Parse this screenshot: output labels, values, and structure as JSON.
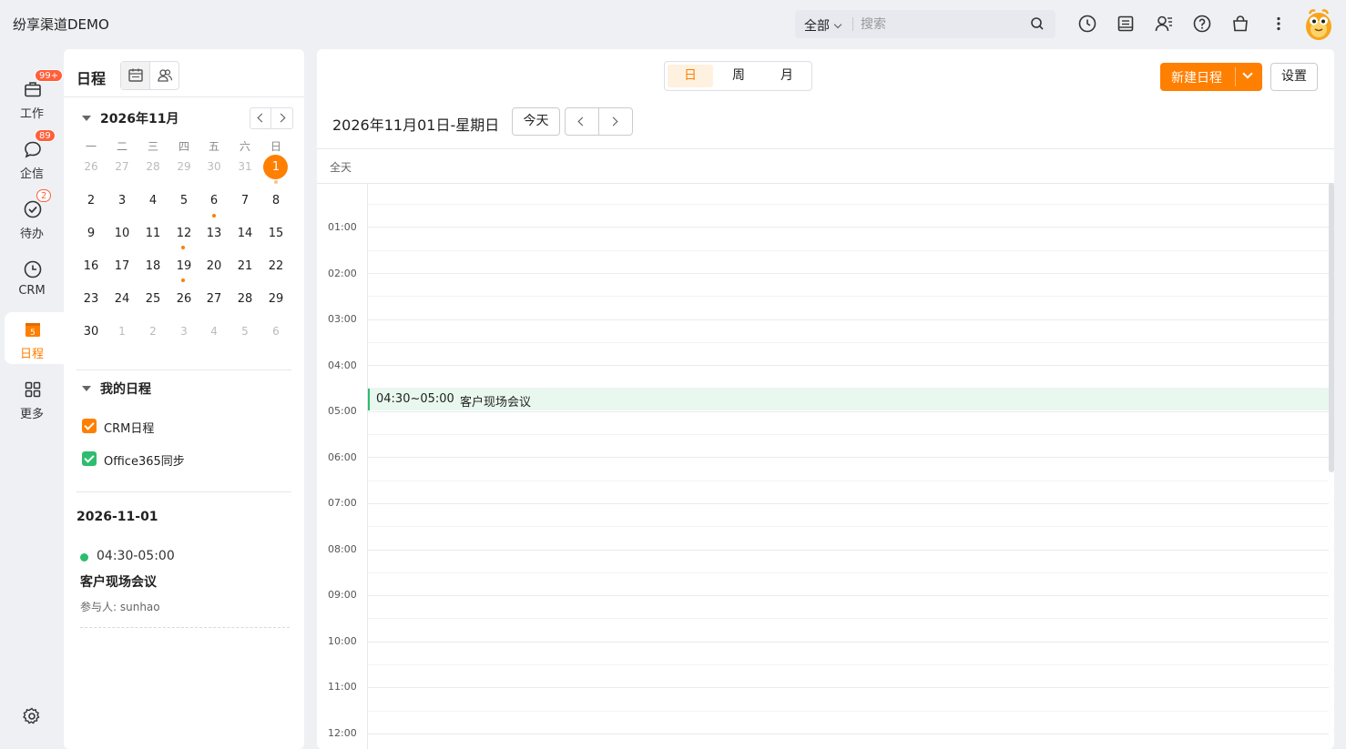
{
  "app": {
    "title": "纷享渠道DEMO"
  },
  "search": {
    "scope": "全部",
    "placeholder": "搜索"
  },
  "topbar_icons": [
    "clock-icon",
    "notes-icon",
    "contacts-icon",
    "help-icon",
    "bag-icon",
    "more-vertical-icon"
  ],
  "nav": {
    "items": [
      {
        "label": "工作",
        "icon": "briefcase-icon",
        "badge": "99+"
      },
      {
        "label": "企信",
        "icon": "chat-icon",
        "badge": "89"
      },
      {
        "label": "待办",
        "icon": "todo-check-icon",
        "badge": "2"
      },
      {
        "label": "CRM",
        "icon": "crm-clock-icon",
        "badge": ""
      },
      {
        "label": "日程",
        "icon": "calendar-icon",
        "badge": "",
        "icon_text": "5"
      },
      {
        "label": "更多",
        "icon": "grid-icon",
        "badge": ""
      }
    ],
    "active": "日程"
  },
  "sidebar": {
    "title": "日程",
    "month_label": "2026年11月",
    "weekdays": [
      "一",
      "二",
      "三",
      "四",
      "五",
      "六",
      "日"
    ],
    "weeks": [
      [
        "26",
        "27",
        "28",
        "29",
        "30",
        "31",
        "1"
      ],
      [
        "2",
        "3",
        "4",
        "5",
        "6",
        "7",
        "8"
      ],
      [
        "9",
        "10",
        "11",
        "12",
        "13",
        "14",
        "15"
      ],
      [
        "16",
        "17",
        "18",
        "19",
        "20",
        "21",
        "22"
      ],
      [
        "23",
        "24",
        "25",
        "26",
        "27",
        "28",
        "29"
      ],
      [
        "30",
        "1",
        "2",
        "3",
        "4",
        "5",
        "6"
      ]
    ],
    "selected_day": "1",
    "my_calendars_title": "我的日程",
    "calendars": [
      {
        "label": "CRM日程",
        "color": "#ff7f00",
        "checked": true
      },
      {
        "label": "Office365同步",
        "color": "#2dbd6e",
        "checked": true
      }
    ],
    "agenda": {
      "date": "2026-11-01",
      "items": [
        {
          "time": "04:30-05:00",
          "title": "客户现场会议",
          "participants": "参与人: sunhao",
          "color": "#2dbd6e"
        }
      ]
    }
  },
  "main": {
    "views": [
      "日",
      "周",
      "月"
    ],
    "active_view": "日",
    "new_button": "新建日程",
    "settings_button": "设置",
    "date_title": "2026年11月01日-星期日",
    "today_button": "今天",
    "allday_label": "全天",
    "hours": [
      "01:00",
      "02:00",
      "03:00",
      "04:00",
      "05:00",
      "06:00",
      "07:00",
      "08:00",
      "09:00",
      "10:00",
      "11:00",
      "12:00"
    ],
    "events": [
      {
        "time": "04:30~05:00",
        "title": "客户现场会议",
        "color": "#2dbd6e"
      }
    ]
  },
  "colors": {
    "accent": "#ff7f00",
    "badge": "#ff5f3a",
    "event": "#2dbd6e"
  }
}
